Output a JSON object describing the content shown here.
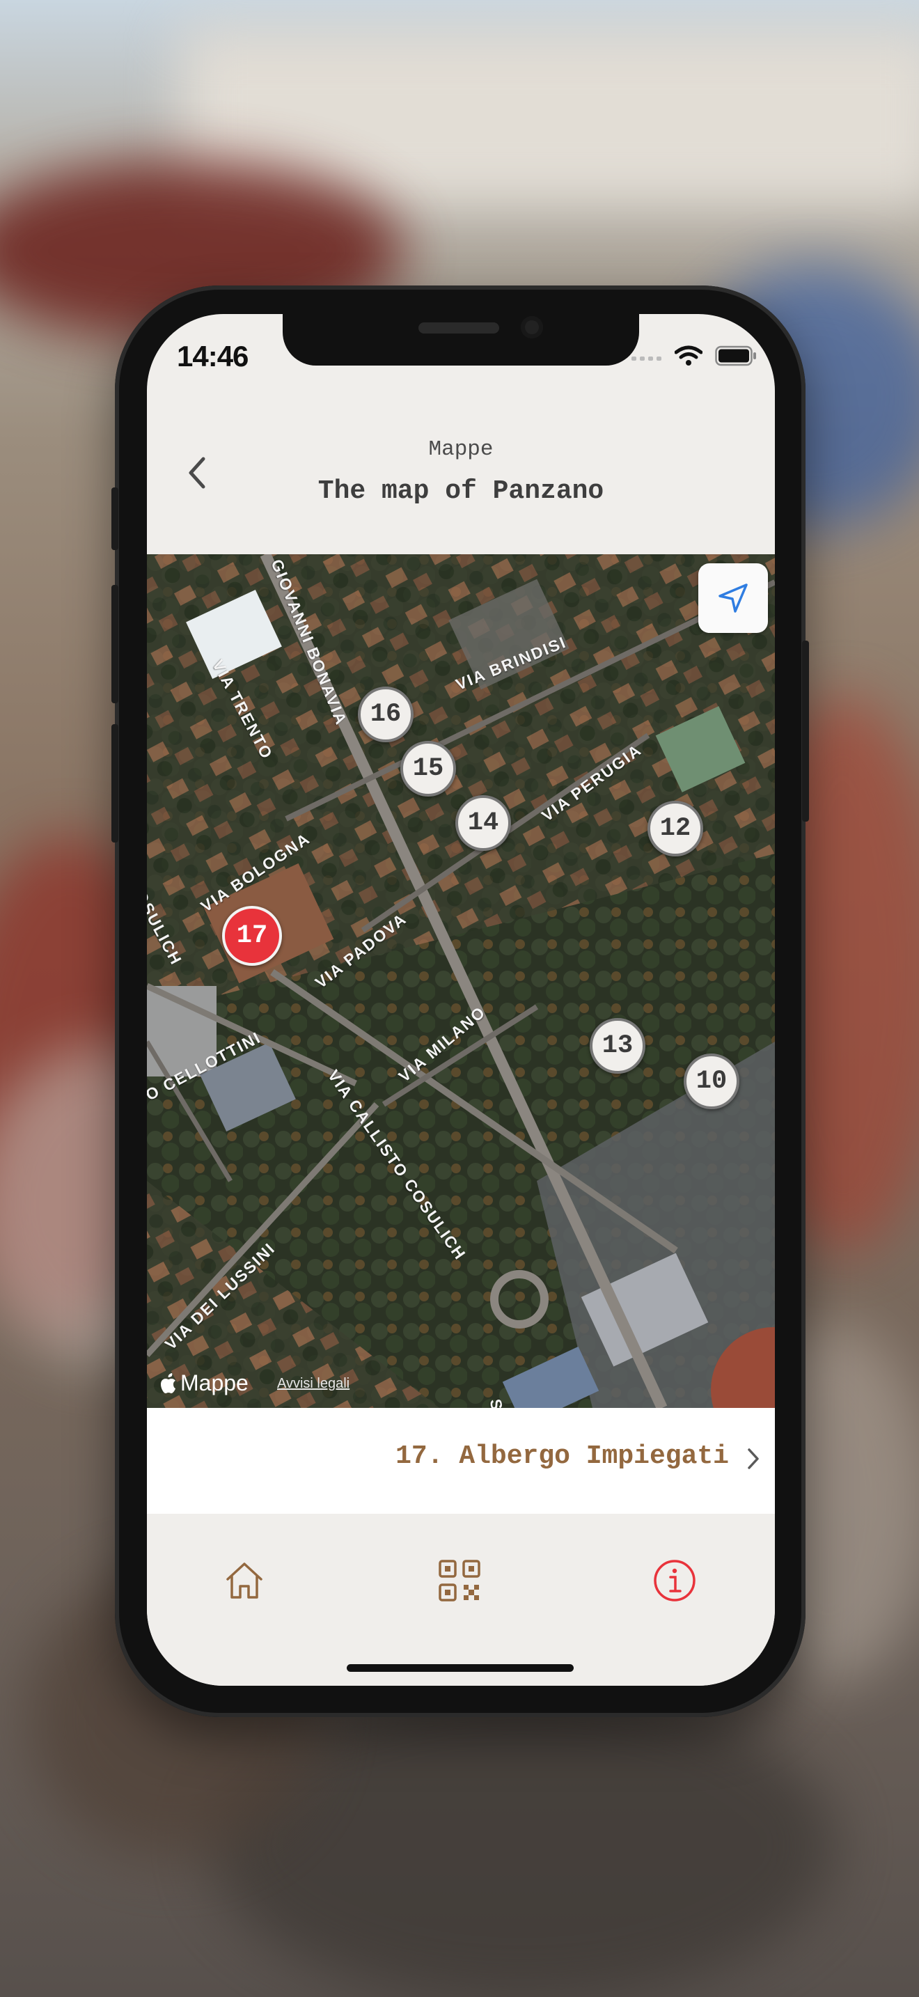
{
  "status_bar": {
    "time": "14:46"
  },
  "header": {
    "eyebrow": "Mappe",
    "title": "The map of Panzano"
  },
  "map": {
    "pins": [
      {
        "number": "16",
        "selected": false
      },
      {
        "number": "15",
        "selected": false
      },
      {
        "number": "14",
        "selected": false
      },
      {
        "number": "12",
        "selected": false
      },
      {
        "number": "17",
        "selected": true
      },
      {
        "number": "13",
        "selected": false
      },
      {
        "number": "10",
        "selected": false
      }
    ],
    "streets": [
      "GIOVANNI BONAVIA",
      "VIA TRENTO",
      "VIA BRINDISI",
      "VIA PERUGIA",
      "VIA BOLOGNA",
      "COSULICH",
      "VIA PADOVA",
      "VIA MILANO",
      "O CELLOTTINI",
      "VIA CALLISTO COSULICH",
      "VIA DEI LUSSINI",
      "SI"
    ],
    "attribution": "Mappe",
    "legal_link": "Avvisi legali"
  },
  "selected_place": {
    "label": "17. Albergo Impiegati"
  },
  "tabbar": {
    "tabs": [
      {
        "icon": "home-icon"
      },
      {
        "icon": "qr-code-icon"
      },
      {
        "icon": "info-icon",
        "active": true
      }
    ]
  },
  "colors": {
    "accent_brown": "#93683f",
    "active_red": "#e8333b",
    "surface": "#f0eeeb"
  }
}
